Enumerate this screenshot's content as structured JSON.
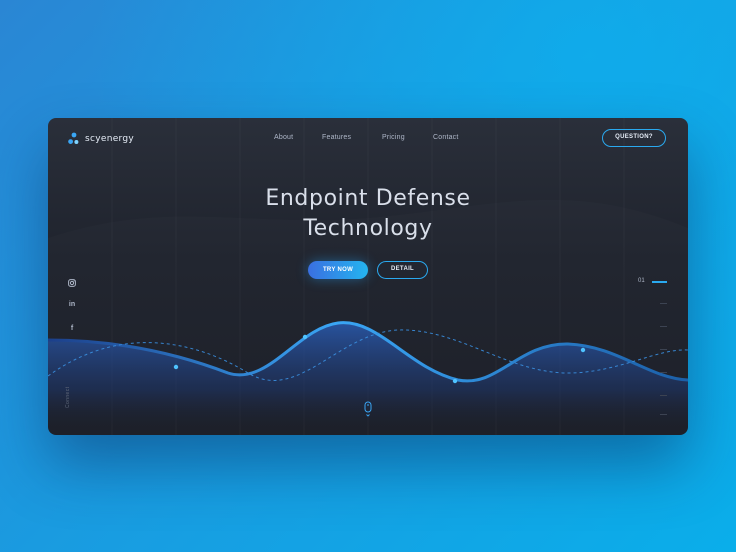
{
  "brand": {
    "name": "scyenergy",
    "logo_icon": "scyenergy-logo-icon"
  },
  "nav": {
    "items": [
      {
        "label": "About"
      },
      {
        "label": "Features"
      },
      {
        "label": "Pricing"
      },
      {
        "label": "Contact"
      }
    ],
    "cta_label": "QUESTION?"
  },
  "hero": {
    "title_line1": "Endpoint Defense",
    "title_line2": "Technology",
    "primary_label": "TRY NOW",
    "secondary_label": "DETAIL"
  },
  "social": {
    "icons": [
      "instagram-icon",
      "linkedin-icon",
      "facebook-icon"
    ],
    "linkedin_glyph": "in",
    "facebook_glyph": "f",
    "connect_label": "Connect"
  },
  "slider": {
    "current": "01"
  },
  "colors": {
    "accent": "#2aa9ef",
    "card_bg": "#1f232d",
    "page_bg": "#1a9be0",
    "text": "#d9dfea"
  }
}
